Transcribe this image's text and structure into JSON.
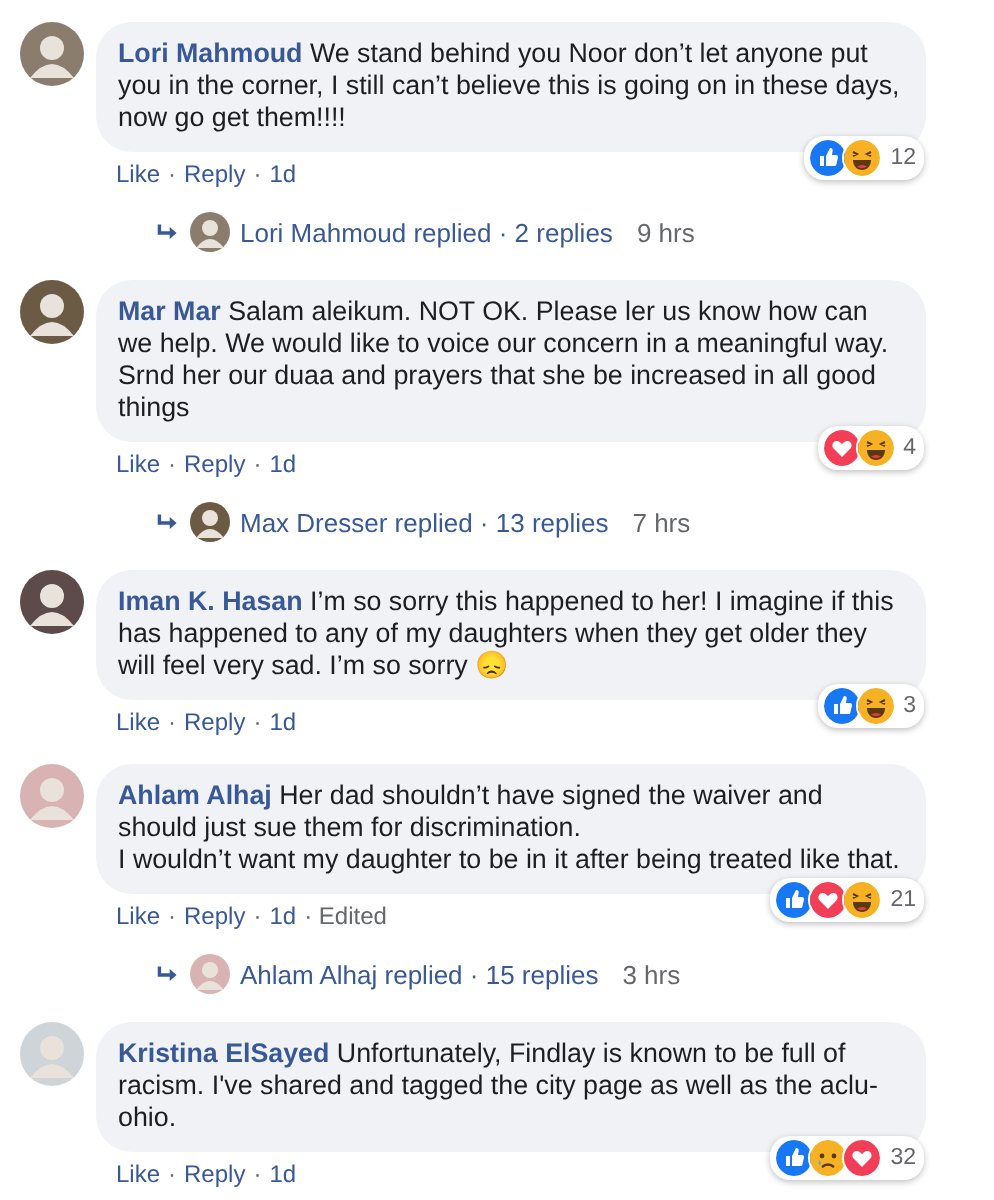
{
  "comments": [
    {
      "author": "Lori Mahmoud",
      "text": "We stand behind you Noor don’t let anyone put you in the corner, I still can’t believe this is going on in these days, now go get them!!!!",
      "reactions": [
        {
          "kind": "like"
        },
        {
          "kind": "haha"
        }
      ],
      "reaction_count": "12",
      "actions": [
        {
          "text": "Like",
          "kind": "link"
        },
        {
          "text": "·",
          "kind": "sep"
        },
        {
          "text": "Reply",
          "kind": "link"
        },
        {
          "text": "·",
          "kind": "sep"
        },
        {
          "text": "1d",
          "kind": "time"
        }
      ],
      "replies": {
        "summary": "Lori Mahmoud replied · 2 replies",
        "time": "9 hrs"
      }
    },
    {
      "author": "Mar Mar",
      "text": "Salam aleikum. NOT OK. Please ler us know how can we help. We would like to voice our concern in a meaningful way. Srnd her our duaa and prayers that she be increased in all good things",
      "reactions": [
        {
          "kind": "love"
        },
        {
          "kind": "haha"
        }
      ],
      "reaction_count": "4",
      "actions": [
        {
          "text": "Like",
          "kind": "link"
        },
        {
          "text": "·",
          "kind": "sep"
        },
        {
          "text": "Reply",
          "kind": "link"
        },
        {
          "text": "·",
          "kind": "sep"
        },
        {
          "text": "1d",
          "kind": "time"
        }
      ],
      "replies": {
        "summary": "Max Dresser replied · 13 replies",
        "time": "7 hrs"
      }
    },
    {
      "author": "Iman K. Hasan",
      "text": "I’m so sorry this happened to her! I imagine if this has happened to any of my daughters when they get older they will feel very sad. I’m so sorry 😞",
      "reactions": [
        {
          "kind": "like"
        },
        {
          "kind": "haha"
        }
      ],
      "reaction_count": "3",
      "actions": [
        {
          "text": "Like",
          "kind": "link"
        },
        {
          "text": "·",
          "kind": "sep"
        },
        {
          "text": "Reply",
          "kind": "link"
        },
        {
          "text": "·",
          "kind": "sep"
        },
        {
          "text": "1d",
          "kind": "time"
        }
      ]
    },
    {
      "author": "Ahlam Alhaj",
      "text": "Her dad shouldn’t have signed the waiver and should just sue them for discrimination.\nI wouldn’t want my daughter to be in it after being treated like that.",
      "reactions": [
        {
          "kind": "like"
        },
        {
          "kind": "love"
        },
        {
          "kind": "haha"
        }
      ],
      "reaction_count": "21",
      "actions": [
        {
          "text": "Like",
          "kind": "link"
        },
        {
          "text": "·",
          "kind": "sep"
        },
        {
          "text": "Reply",
          "kind": "link"
        },
        {
          "text": "·",
          "kind": "sep"
        },
        {
          "text": "1d",
          "kind": "time"
        },
        {
          "text": "· Edited",
          "kind": "meta"
        }
      ],
      "replies": {
        "summary": "Ahlam Alhaj replied · 15 replies",
        "time": "3 hrs"
      }
    },
    {
      "author": "Kristina ElSayed",
      "text": "Unfortunately, Findlay is known to be full of racism. I've shared and tagged the city page as well as the aclu-ohio.",
      "reactions": [
        {
          "kind": "like"
        },
        {
          "kind": "sad"
        },
        {
          "kind": "love"
        }
      ],
      "reaction_count": "32",
      "actions": [
        {
          "text": "Like",
          "kind": "link"
        },
        {
          "text": "·",
          "kind": "sep"
        },
        {
          "text": "Reply",
          "kind": "link"
        },
        {
          "text": "·",
          "kind": "sep"
        },
        {
          "text": "1d",
          "kind": "time"
        }
      ]
    }
  ]
}
